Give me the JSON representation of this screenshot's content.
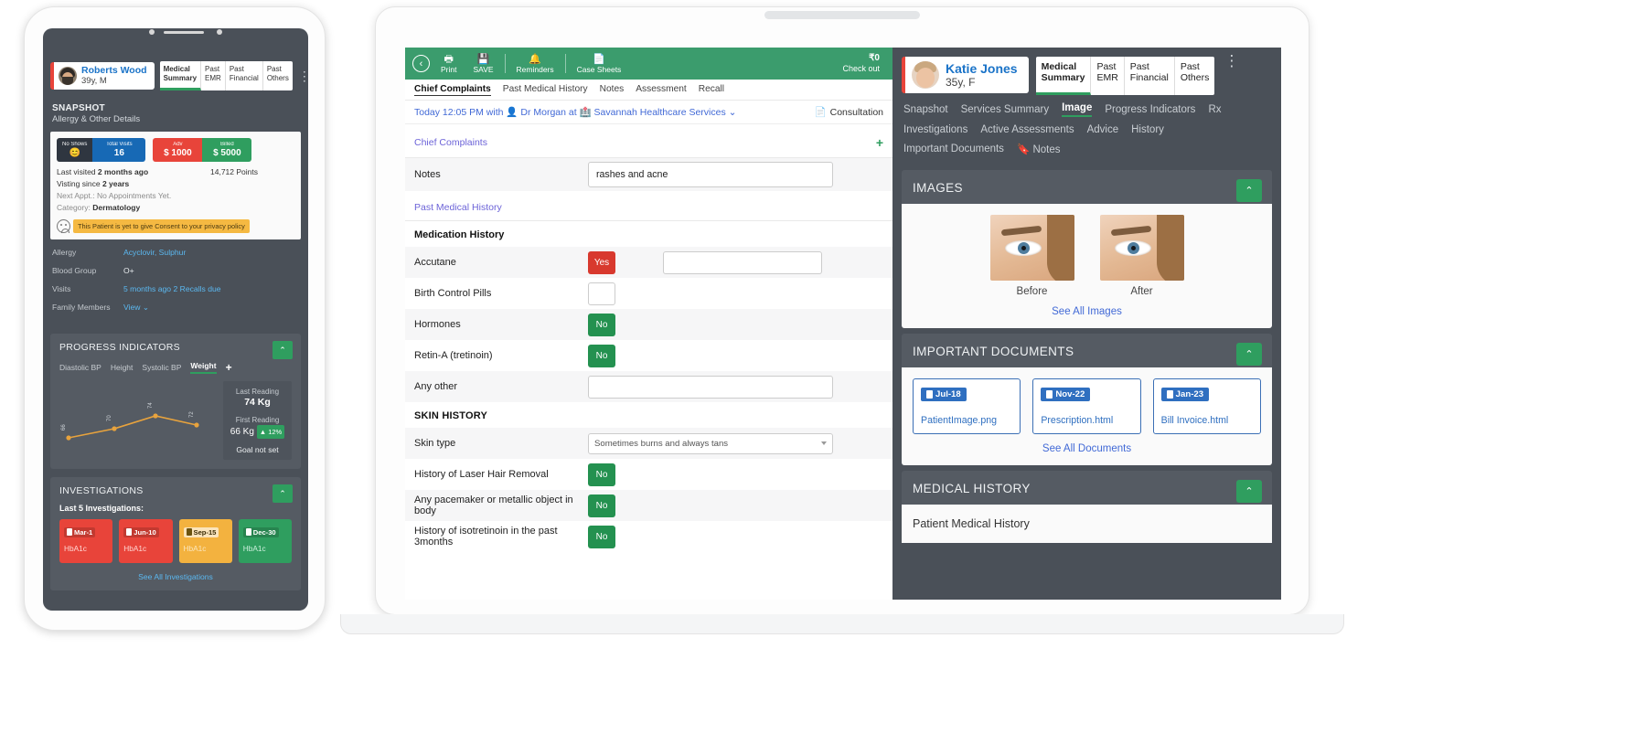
{
  "phone": {
    "patient": {
      "name": "Roberts Wood",
      "age_sex": "39y, M",
      "avatar": "patient-avatar"
    },
    "tabs": [
      {
        "label": "Medical\nSummary",
        "active": true
      },
      {
        "label": "Past\nEMR",
        "active": false
      },
      {
        "label": "Past\nFinancial",
        "active": false
      },
      {
        "label": "Past\nOthers",
        "active": false
      }
    ],
    "kebab": "⋮",
    "snapshot": {
      "title": "SNAPSHOT",
      "subtitle": "Allergy & Other Details",
      "badges": [
        {
          "title": "No Shows",
          "value": "😊",
          "color": "#2f3640"
        },
        {
          "title": "Total Visits",
          "value": "16",
          "color": "#1769b5"
        },
        {
          "title": "Adv",
          "value": "$ 1000",
          "color": "#e8443a"
        },
        {
          "title": "Billed",
          "value": "$ 5000",
          "color": "#2f9e5f"
        }
      ],
      "last_visited_label": "Last visited",
      "last_visited_value": "2 months ago",
      "visiting_label": "Visting since",
      "visiting_value": "2 years",
      "next_appt": "Next Appt.: No Appointments Yet.",
      "category_label": "Category:",
      "category_value": "Dermatology",
      "points": "14,712 Points",
      "consent_warning": "This Patient is yet to give Consent to your privacy policy"
    },
    "details": [
      {
        "key": "Allergy",
        "value": "Acyclovir, Sulphur",
        "link": true
      },
      {
        "key": "Blood Group",
        "value": "O+",
        "link": false
      },
      {
        "key": "Visits",
        "value": "5 months ago        2 Recalls due",
        "link": true
      },
      {
        "key": "Family Members",
        "value": "View ⌄",
        "link": true
      }
    ],
    "progress": {
      "title": "PROGRESS INDICATORS",
      "collapse_icon": "⌃",
      "tabs": [
        "Diastolic BP",
        "Height",
        "Systolic BP",
        "Weight"
      ],
      "active_tab": "Weight",
      "add_icon": "+",
      "last_reading_label": "Last Reading",
      "last_reading_value": "74 Kg",
      "first_reading_label": "First Reading",
      "first_reading_value": "66 Kg",
      "change_badge": "▲ 12%",
      "goal": "Goal not set"
    },
    "investigations": {
      "title": "INVESTIGATIONS",
      "collapse_icon": "⌃",
      "subtitle": "Last 5 Investigations:",
      "items": [
        {
          "date": "Mar-1",
          "name": "HbA1c",
          "color": "red"
        },
        {
          "date": "Jun-10",
          "name": "HbA1c",
          "color": "red"
        },
        {
          "date": "Sep-15",
          "name": "HbA1c",
          "color": "amber"
        },
        {
          "date": "Dec-30",
          "name": "HbA1c",
          "color": "green"
        }
      ],
      "see_all": "See All Investigations"
    }
  },
  "laptop": {
    "toolbar": {
      "back_icon": "‹",
      "items": [
        {
          "icon": "🖶",
          "label": "Print",
          "name": "print"
        },
        {
          "icon": "💾",
          "label": "SAVE",
          "name": "save"
        },
        {
          "icon": "🔔",
          "label": "Reminders",
          "name": "reminders"
        },
        {
          "icon": "📄",
          "label": "Case Sheets",
          "name": "case-sheets"
        }
      ],
      "amount": "₹0",
      "checkout": "Check out"
    },
    "sub_tabs": [
      {
        "label": "Chief Complaints",
        "active": true
      },
      {
        "label": "Past Medical History",
        "active": false
      },
      {
        "label": "Notes",
        "active": false
      },
      {
        "label": "Assessment",
        "active": false
      },
      {
        "label": "Recall",
        "active": false
      }
    ],
    "appointment": {
      "text": "Today 12:05 PM with 👤 Dr Morgan at 🏥 Savannah Healthcare Services ⌄",
      "consultation_icon": "📄",
      "consultation": "Consultation"
    },
    "chief_complaints": {
      "title": "Chief Complaints",
      "add_icon": "+"
    },
    "notes": {
      "label": "Notes",
      "value": "rashes and acne",
      "placeholder": ""
    },
    "past_medical_history": {
      "title": "Past Medical History"
    },
    "medication_history": {
      "title": "Medication History",
      "rows": [
        {
          "label": "Accutane",
          "control": "button",
          "value": "Yes",
          "state": "yes",
          "has_input": true,
          "input_value": ""
        },
        {
          "label": "Birth Control Pills",
          "control": "empty",
          "value": "",
          "state": "none",
          "has_input": false
        },
        {
          "label": "Hormones",
          "control": "button",
          "value": "No",
          "state": "no",
          "has_input": false
        },
        {
          "label": "Retin-A (tretinoin)",
          "control": "button",
          "value": "No",
          "state": "no",
          "has_input": false
        },
        {
          "label": "Any other",
          "control": "input",
          "value": "",
          "state": "none",
          "has_input": true
        }
      ]
    },
    "skin_history": {
      "title": "SKIN HISTORY",
      "rows": [
        {
          "label": "Skin type",
          "control": "select",
          "value": "Sometimes burns and always tans",
          "state": "none"
        },
        {
          "label": "History of Laser Hair Removal",
          "control": "button",
          "value": "No",
          "state": "no"
        },
        {
          "label": "Any pacemaker or metallic object in body",
          "control": "button",
          "value": "No",
          "state": "no"
        },
        {
          "label": "History of isotretinoin in the past 3months",
          "control": "button",
          "value": "No",
          "state": "no"
        }
      ]
    }
  },
  "right_panel": {
    "patient": {
      "name": "Katie Jones",
      "age_sex": "35y, F",
      "avatar": "patient-avatar"
    },
    "tabs": [
      {
        "label": "Medical\nSummary",
        "active": true
      },
      {
        "label": "Past\nEMR",
        "active": false
      },
      {
        "label": "Past\nFinancial",
        "active": false
      },
      {
        "label": "Past\nOthers",
        "active": false
      }
    ],
    "kebab": "⋮",
    "nav": [
      {
        "label": "Snapshot",
        "active": false
      },
      {
        "label": "Services Summary",
        "active": false
      },
      {
        "label": "Image",
        "active": true
      },
      {
        "label": "Progress Indicators",
        "active": false
      },
      {
        "label": "Rx",
        "active": false
      },
      {
        "label": "Investigations",
        "active": false
      },
      {
        "label": "Active Assessments",
        "active": false
      },
      {
        "label": "Advice",
        "active": false
      },
      {
        "label": "History",
        "active": false
      },
      {
        "label": "Important Documents",
        "active": false
      },
      {
        "label": "🔖 Notes",
        "active": false
      }
    ],
    "images": {
      "title": "IMAGES",
      "collapse_icon": "⌃",
      "items": [
        {
          "caption": "Before"
        },
        {
          "caption": "After"
        }
      ],
      "see_all": "See All Images"
    },
    "documents": {
      "title": "IMPORTANT DOCUMENTS",
      "collapse_icon": "⌃",
      "items": [
        {
          "date": "Jul-18",
          "name": "PatientImage.png"
        },
        {
          "date": "Nov-22",
          "name": "Prescription.html"
        },
        {
          "date": "Jan-23",
          "name": "Bill Invoice.html"
        }
      ],
      "see_all": "See All Documents"
    },
    "medical_history": {
      "title": "MEDICAL HISTORY",
      "collapse_icon": "⌃",
      "body": "Patient Medical History"
    }
  },
  "colors": {
    "green": "#2f9e5f",
    "toolbar_green": "#3b9c6d",
    "red": "#d8392e",
    "blue": "#2f6fc0",
    "dark_panel": "#4a5058",
    "card_panel": "#555b63",
    "link_blue": "#4169d6",
    "purple_link": "#6c63d8"
  }
}
